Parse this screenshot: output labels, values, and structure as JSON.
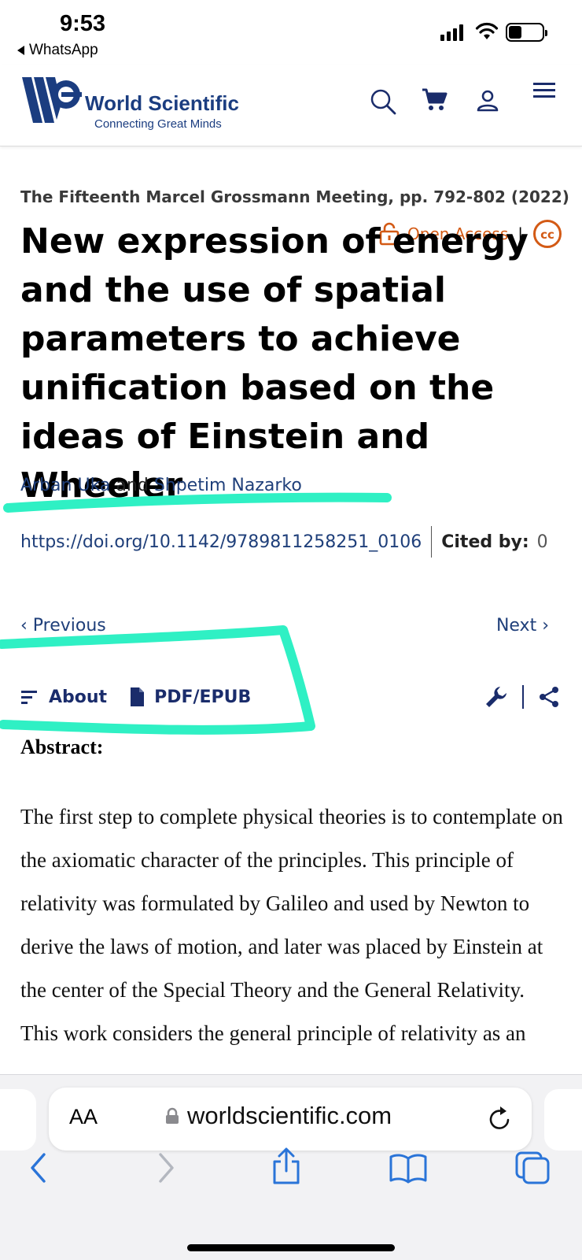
{
  "status_bar": {
    "time": "9:53",
    "back_app": "WhatsApp"
  },
  "site": {
    "brand_name": "World Scientific",
    "brand_tagline": "Connecting Great Minds",
    "brand_color": "#1b3d80",
    "icons": [
      "search-icon",
      "cart-icon",
      "account-icon",
      "menu-icon"
    ]
  },
  "article": {
    "meeting": "The Fifteenth Marcel Grossmann Meeting, pp. 792-802 (2022)",
    "title": "New expression of energy and the use of spatial parameters to achieve unification based on the ideas of Einstein and Wheeler",
    "open_access_label": "Open Access",
    "separator": "|",
    "cc_label": "cc",
    "authors": {
      "author1": "Arban Uka",
      "conjunction": "and",
      "author2": "Shpetim Nazarko"
    },
    "doi": "https://doi.org/10.1142/9789811258251_0106",
    "cited_by_label": "Cited by:",
    "cited_by_count": "0",
    "accent_color": "#d35a15"
  },
  "navigation": {
    "previous": "Previous",
    "next": "Next"
  },
  "tabs": {
    "about": "About",
    "pdf": "PDF/EPUB"
  },
  "abstract": {
    "heading": "Abstract:",
    "text": "The first step to complete physical theories is to contemplate on the axiomatic character of the principles. This principle of relativity was formulated by Galileo and used by Newton to derive the laws of motion, and later was placed by Einstein at the center of the Special Theory and the General Relativity. This work considers the general principle of relativity as an"
  },
  "annotation": {
    "highlighter_color": "#2ff0c4"
  },
  "browser": {
    "text_size_button": "AA",
    "url": "worldscientific.com",
    "toolbar": [
      "back-icon",
      "forward-icon",
      "share-icon",
      "bookmarks-icon",
      "tabs-icon"
    ]
  }
}
